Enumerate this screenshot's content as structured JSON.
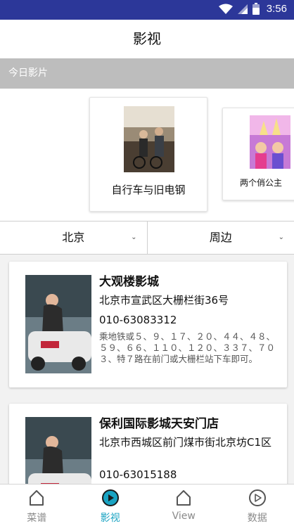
{
  "status_bar": {
    "time": "3:56",
    "icons": [
      "wifi-icon",
      "signal-icon",
      "battery-icon"
    ]
  },
  "header": {
    "title": "影视"
  },
  "section": {
    "title": "今日影片"
  },
  "movies": [
    {
      "title": "自行车与旧电钢",
      "poster_text": "自行车与旧电钢"
    },
    {
      "title": "两个俏公主",
      "poster_text": "两个俏公主"
    }
  ],
  "filters": [
    {
      "label": "北京"
    },
    {
      "label": "周边"
    }
  ],
  "cinemas": [
    {
      "name": "大观楼影城",
      "address": "北京市宣武区大栅栏街36号",
      "phone": "010-63083312",
      "route": "乘地铁或５、９、１７、２０、４４、４８、５９、６６、１１０、１２０、３３７、７０３、特７路在前门或大栅栏站下车即可。"
    },
    {
      "name": "保利国际影城天安门店",
      "address": "北京市西城区前门煤市街北京坊C1区",
      "phone": "010-63015188",
      "route": ""
    }
  ],
  "bottom_nav": [
    {
      "label": "菜谱",
      "icon": "home-icon",
      "active": false
    },
    {
      "label": "影视",
      "icon": "play-circle-icon",
      "active": true
    },
    {
      "label": "View",
      "icon": "home-icon",
      "active": false
    },
    {
      "label": "数据",
      "icon": "play-circle-icon",
      "active": false
    }
  ],
  "colors": {
    "status_bar": "#2c3799",
    "section_header": "#bdbdbd",
    "accent": "#19a3c2",
    "nav_inactive": "#8a8a8a"
  }
}
